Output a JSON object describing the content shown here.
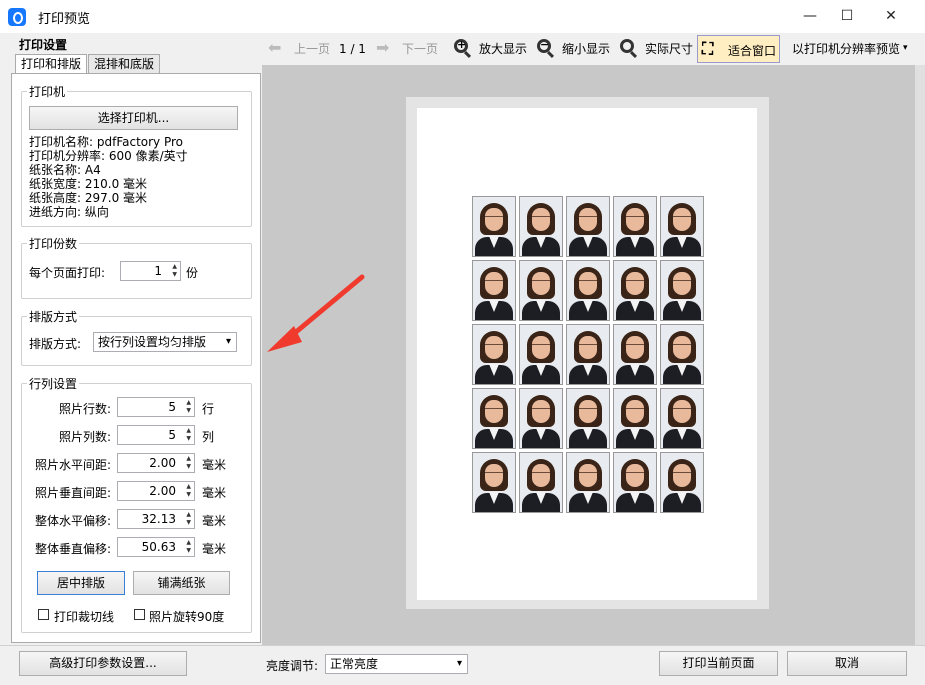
{
  "window": {
    "title": "打印预览",
    "minimize": "—",
    "maximize": "☐",
    "close": "✕"
  },
  "left": {
    "heading": "打印设置",
    "tabs": [
      {
        "label": "打印和排版"
      },
      {
        "label": "混排和底版"
      }
    ],
    "printer": {
      "group_label": "打印机",
      "select_button": "选择打印机...",
      "name": "打印机名称: pdfFactory Pro",
      "resolution": "打印机分辨率: 600 像素/英寸",
      "paper_name": "纸张名称: A4",
      "paper_width": "纸张宽度: 210.0 毫米",
      "paper_height": "纸张高度: 297.0 毫米",
      "feed_direction": "进纸方向: 纵向"
    },
    "copies": {
      "group_label": "打印份数",
      "label": "每个页面打印:",
      "value": "1",
      "unit": "份"
    },
    "layout": {
      "group_label": "排版方式",
      "label": "排版方式:",
      "value": "按行列设置均匀排版"
    },
    "grid": {
      "group_label": "行列设置",
      "rows_label": "照片行数:",
      "rows_value": "5",
      "rows_unit": "行",
      "cols_label": "照片列数:",
      "cols_value": "5",
      "cols_unit": "列",
      "hgap_label": "照片水平间距:",
      "hgap_value": "2.00",
      "hgap_unit": "毫米",
      "vgap_label": "照片垂直间距:",
      "vgap_value": "2.00",
      "vgap_unit": "毫米",
      "hoffset_label": "整体水平偏移:",
      "hoffset_value": "32.13",
      "hoffset_unit": "毫米",
      "voffset_label": "整体垂直偏移:",
      "voffset_value": "50.63",
      "voffset_unit": "毫米",
      "center_button": "居中排版",
      "fill_button": "铺满纸张",
      "cut_lines": "打印裁切线",
      "rotate": "照片旋转90度"
    }
  },
  "toolbar": {
    "prev": "上一页",
    "page": "1 / 1",
    "next": "下一页",
    "zoom_in": "放大显示",
    "zoom_out": "缩小显示",
    "actual_size": "实际尺寸",
    "fit_window": "适合窗口",
    "preview_mode": "以打印机分辨率预览"
  },
  "preview": {
    "rows": 5,
    "cols": 5
  },
  "bottom": {
    "advanced": "高级打印参数设置...",
    "brightness_label": "亮度调节:",
    "brightness_value": "正常亮度",
    "print_current": "打印当前页面",
    "cancel": "取消"
  },
  "colors": {
    "accent": "#1677ff",
    "arrow": "#f03a2e"
  }
}
